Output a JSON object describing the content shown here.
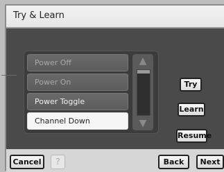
{
  "window": {
    "title": "Try & Learn"
  },
  "list": {
    "items": [
      {
        "label": "Power Off",
        "state": "inactive"
      },
      {
        "label": "Power On",
        "state": "inactive"
      },
      {
        "label": "Power Toggle",
        "state": "active"
      },
      {
        "label": "Channel Down",
        "state": "selected"
      }
    ],
    "scroll_up_icon": "triangle-up-icon",
    "scroll_down_icon": "triangle-down-icon",
    "scroll_up_glyph": "▲",
    "scroll_down_glyph": "▼"
  },
  "actions": {
    "try_label": "Try",
    "learn_label": "Learn",
    "resume_label": "Resume"
  },
  "footer": {
    "cancel_label": "Cancel",
    "help_label": "?",
    "back_label": "Back",
    "next_label": "Next"
  },
  "colors": {
    "content_background": "#4a4a4a",
    "selected_item": "#f6f6f6",
    "title_bar": "#eeeeee"
  }
}
